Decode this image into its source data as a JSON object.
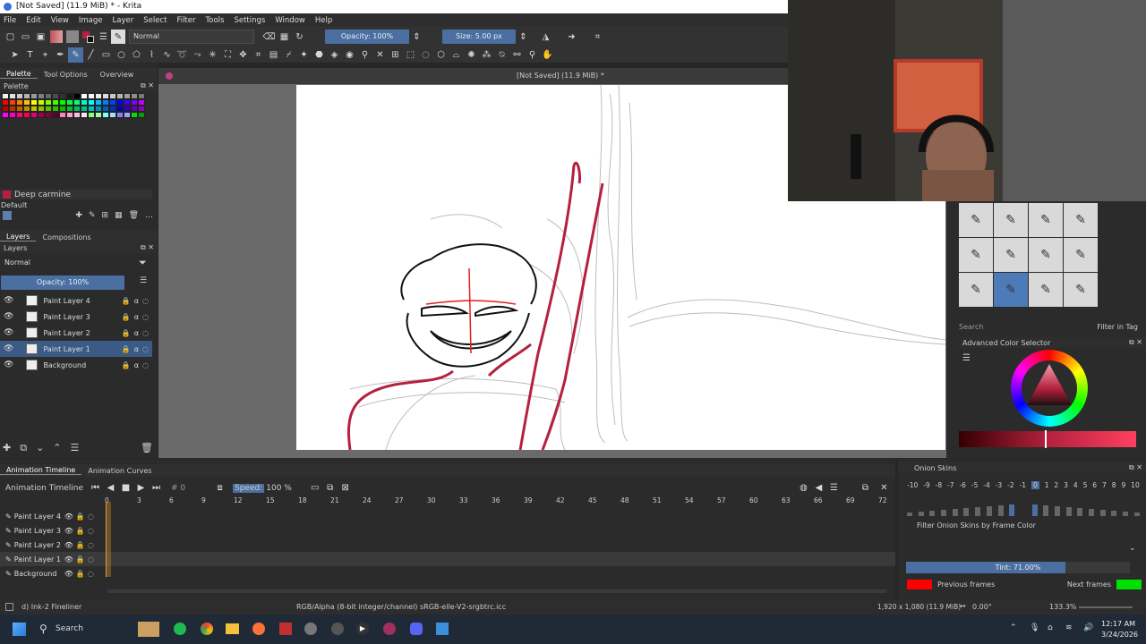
{
  "window": {
    "title": "[Not Saved]  (11.9 MiB) * - Krita"
  },
  "menu": [
    "File",
    "Edit",
    "View",
    "Image",
    "Layer",
    "Select",
    "Filter",
    "Tools",
    "Settings",
    "Window",
    "Help"
  ],
  "toolbar": {
    "blend_mode": "Normal",
    "opacity_label": "Opacity: 100%",
    "size_label": "Size: 5.00 px"
  },
  "document": {
    "header": "[Not Saved]  (11.9 MiB) *"
  },
  "left_dock": {
    "tabs": [
      "Palette",
      "Tool Options",
      "Overview"
    ],
    "palette_title": "Palette",
    "color_name": "Deep carmine",
    "palette_set": "Default",
    "swatch_colors": [
      "#f2f2f2",
      "#e0e0e0",
      "#cccccc",
      "#b3b3b3",
      "#999999",
      "#808080",
      "#666666",
      "#4d4d4d",
      "#333333",
      "#1a1a1a",
      "#000000",
      "#ffffff",
      "#f5f5f5",
      "#ebebeb",
      "#dcdcdc",
      "#c8c8c8",
      "#b4b4b4",
      "#a0a0a0",
      "#8c8c8c",
      "#787878",
      "#ff0000",
      "#ff4000",
      "#ff8000",
      "#ffbf00",
      "#ffff00",
      "#bfff00",
      "#80ff00",
      "#40ff00",
      "#00ff00",
      "#00ff40",
      "#00ff80",
      "#00ffbf",
      "#00ffff",
      "#00bfff",
      "#0080ff",
      "#0040ff",
      "#0000ff",
      "#4000ff",
      "#8000ff",
      "#bf00ff",
      "#c00000",
      "#c03000",
      "#c06000",
      "#c09000",
      "#c0c000",
      "#90c000",
      "#60c000",
      "#30c000",
      "#00c000",
      "#00c030",
      "#00c060",
      "#00c090",
      "#00c0c0",
      "#0090c0",
      "#0060c0",
      "#0030c0",
      "#0000c0",
      "#3000c0",
      "#6000c0",
      "#9000c0",
      "#ff00ff",
      "#ff00bf",
      "#ff0080",
      "#ff0040",
      "#e0007a",
      "#a0004a",
      "#800040",
      "#600030",
      "#ff80c0",
      "#ffa0d0",
      "#ffc0e0",
      "#ffe0f0",
      "#80ff80",
      "#a0ffa0",
      "#80ffff",
      "#a0e0ff",
      "#8080ff",
      "#a0a0ff",
      "#00e000",
      "#00a000"
    ],
    "layers_tabs": [
      "Layers",
      "Compositions"
    ],
    "layers_title": "Layers",
    "layer_blend": "Normal",
    "layer_opacity": "Opacity:  100%",
    "layers": [
      {
        "name": "Paint Layer 4",
        "selected": false
      },
      {
        "name": "Paint Layer 3",
        "selected": false
      },
      {
        "name": "Paint Layer 2",
        "selected": false
      },
      {
        "name": "Paint Layer 1",
        "selected": true
      },
      {
        "name": "Background",
        "selected": false
      }
    ]
  },
  "right_dock": {
    "search_placeholder": "Search",
    "filter_in_tag": "Filter in Tag",
    "color_selector_title": "Advanced Color Selector"
  },
  "timeline": {
    "tabs": [
      "Animation Timeline",
      "Animation Curves"
    ],
    "title": "Animation Timeline",
    "frame": "# 0",
    "speed_label": "Speed:",
    "speed_value": "100 %",
    "ticks": [
      "0",
      "3",
      "6",
      "9",
      "12",
      "15",
      "18",
      "21",
      "24",
      "27",
      "30",
      "33",
      "36",
      "39",
      "42",
      "45",
      "48",
      "51",
      "54",
      "57",
      "60",
      "63",
      "66",
      "69",
      "72"
    ],
    "layers": [
      "Paint Layer 4",
      "Paint Layer 3",
      "Paint Layer 2",
      "Paint Layer 1",
      "Background"
    ]
  },
  "onion": {
    "title": "Onion Skins",
    "numbers": [
      "-10",
      "-9",
      "-8",
      "-7",
      "-6",
      "-5",
      "-4",
      "-3",
      "-2",
      "-1",
      "0",
      "1",
      "2",
      "3",
      "4",
      "5",
      "6",
      "7",
      "8",
      "9",
      "10"
    ],
    "filter_label": "Filter Onion Skins by Frame Color",
    "tint_label": "Tint: 71.00%",
    "tint": 0.71,
    "previous_label": "Previous frames",
    "next_label": "Next frames",
    "previous_color": "#ff0000",
    "next_color": "#00e000"
  },
  "status": {
    "brush": "d) Ink-2 Fineliner",
    "color_info": "RGB/Alpha (8-bit integer/channel)  sRGB-elle-V2-srgbtrc.icc",
    "dims": "1,920 x 1,080 (11.9 MiB)",
    "rotation": "0.00°",
    "zoom": "133.3%"
  },
  "taskbar": {
    "search": "Search",
    "time": "12:17 AM",
    "date": "3/24/2026"
  },
  "colors": {
    "accent": "#4a6fa0",
    "selection": "#3b5a86",
    "foreground": "#b5203e"
  }
}
